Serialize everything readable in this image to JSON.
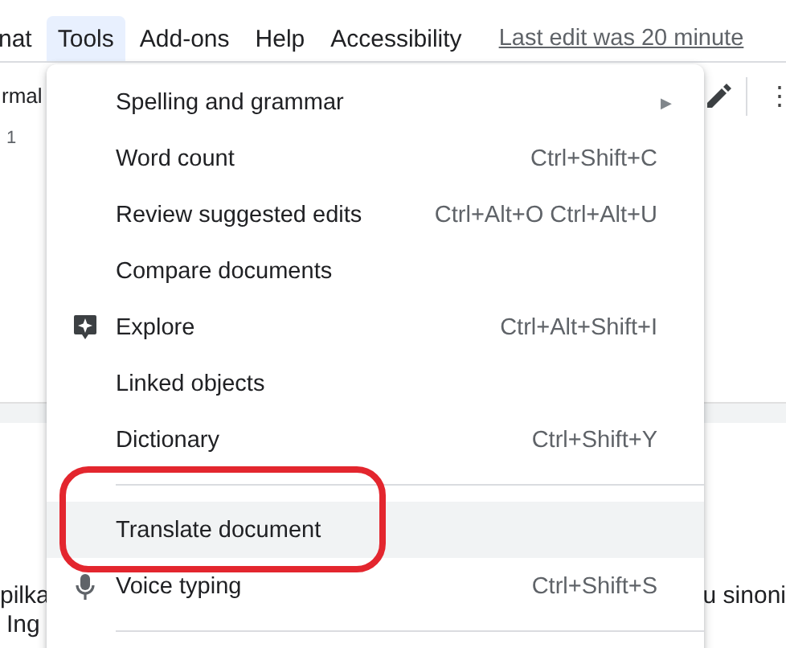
{
  "menubar": [
    {
      "label": "nat",
      "selected": false
    },
    {
      "label": "Tools",
      "selected": true
    },
    {
      "label": "Add-ons",
      "selected": false
    },
    {
      "label": "Help",
      "selected": false
    },
    {
      "label": "Accessibility",
      "selected": false
    }
  ],
  "last_edit": "Last edit was 20 minute",
  "toolbar": {
    "style_select": "rmal",
    "more": "⋮"
  },
  "ruler": {
    "mark": "1"
  },
  "document": {
    "line_1_left": "pilka",
    "line_1_right": "u sinoni",
    "line_2": "Ing"
  },
  "tools_menu": [
    {
      "kind": "item",
      "label": "Spelling and grammar",
      "submenu_arrow": "▶",
      "selected": false,
      "circled": false
    },
    {
      "kind": "item",
      "label": "Word count",
      "shortcut": "Ctrl+Shift+C",
      "selected": false,
      "circled": false
    },
    {
      "kind": "item",
      "label": "Review suggested edits",
      "shortcut": "Ctrl+Alt+O Ctrl+Alt+U",
      "selected": false,
      "circled": false
    },
    {
      "kind": "item",
      "label": "Compare documents",
      "selected": false,
      "circled": false
    },
    {
      "kind": "explore",
      "label": "Explore",
      "shortcut": "Ctrl+Alt+Shift+I",
      "selected": false,
      "circled": false
    },
    {
      "kind": "item",
      "label": "Linked objects",
      "selected": false,
      "circled": false
    },
    {
      "kind": "item",
      "label": "Dictionary",
      "shortcut": "Ctrl+Shift+Y",
      "selected": false,
      "circled": false
    },
    {
      "kind": "separator"
    },
    {
      "kind": "item",
      "label": "Translate document",
      "selected": true,
      "circled": true
    },
    {
      "kind": "voice",
      "label": "Voice typing",
      "shortcut": "Ctrl+Shift+S",
      "selected": false,
      "circled": false
    },
    {
      "kind": "separator"
    }
  ]
}
